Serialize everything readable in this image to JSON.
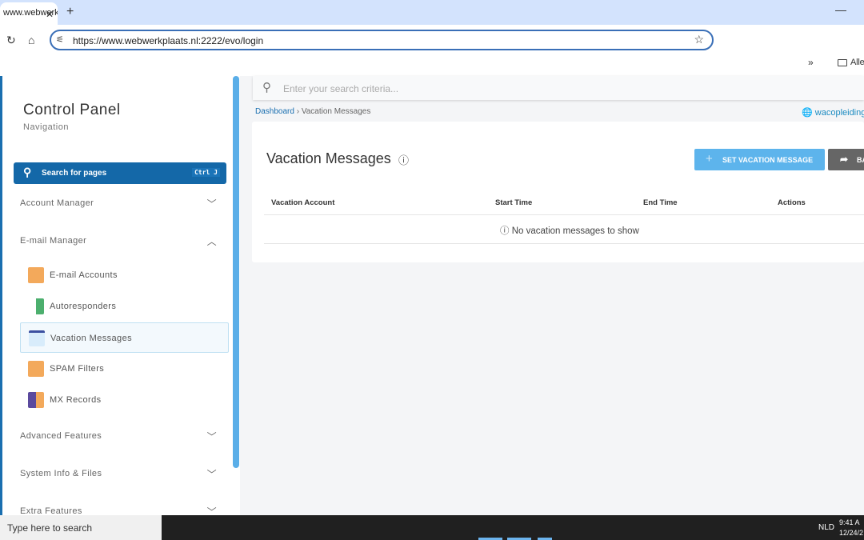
{
  "browser": {
    "tab_title": "www.webwerkplaats.nl",
    "url": "https://www.webwerkplaats.nl:2222/evo/login",
    "bookmark_folder": "Alle"
  },
  "sidebar": {
    "title": "Control Panel",
    "subtitle": "Navigation",
    "search_label": "Search for pages",
    "search_shortcut": "Ctrl J",
    "sections": [
      {
        "label": "Account Manager",
        "expanded": false
      },
      {
        "label": "E-mail Manager",
        "expanded": true
      },
      {
        "label": "Advanced Features",
        "expanded": false
      },
      {
        "label": "System Info & Files",
        "expanded": false
      },
      {
        "label": "Extra Features",
        "expanded": false
      }
    ],
    "email_items": [
      {
        "label": "E-mail Accounts",
        "icon": "envelope-icon"
      },
      {
        "label": "Autoresponders",
        "icon": "autoresponder-icon"
      },
      {
        "label": "Vacation Messages",
        "icon": "vacation-icon",
        "active": true
      },
      {
        "label": "SPAM Filters",
        "icon": "spam-filter-icon"
      },
      {
        "label": "MX Records",
        "icon": "mx-records-icon"
      }
    ]
  },
  "main": {
    "search_placeholder": "Enter your search criteria...",
    "breadcrumb": [
      "Dashboard",
      "Vacation Messages"
    ],
    "domain": "wacopleiding",
    "page_title": "Vacation Messages",
    "set_button": "SET VACATION MESSAGE",
    "back_button": "BA",
    "columns": [
      "Vacation Account",
      "Start Time",
      "End Time",
      "Actions"
    ],
    "empty_text": "No vacation messages to show"
  },
  "taskbar": {
    "search_placeholder": "Type here to search",
    "language": "NLD",
    "time": "9:41 A",
    "date": "12/24/2"
  },
  "colors": {
    "accent": "#1468a8",
    "button": "#5db4ec"
  }
}
